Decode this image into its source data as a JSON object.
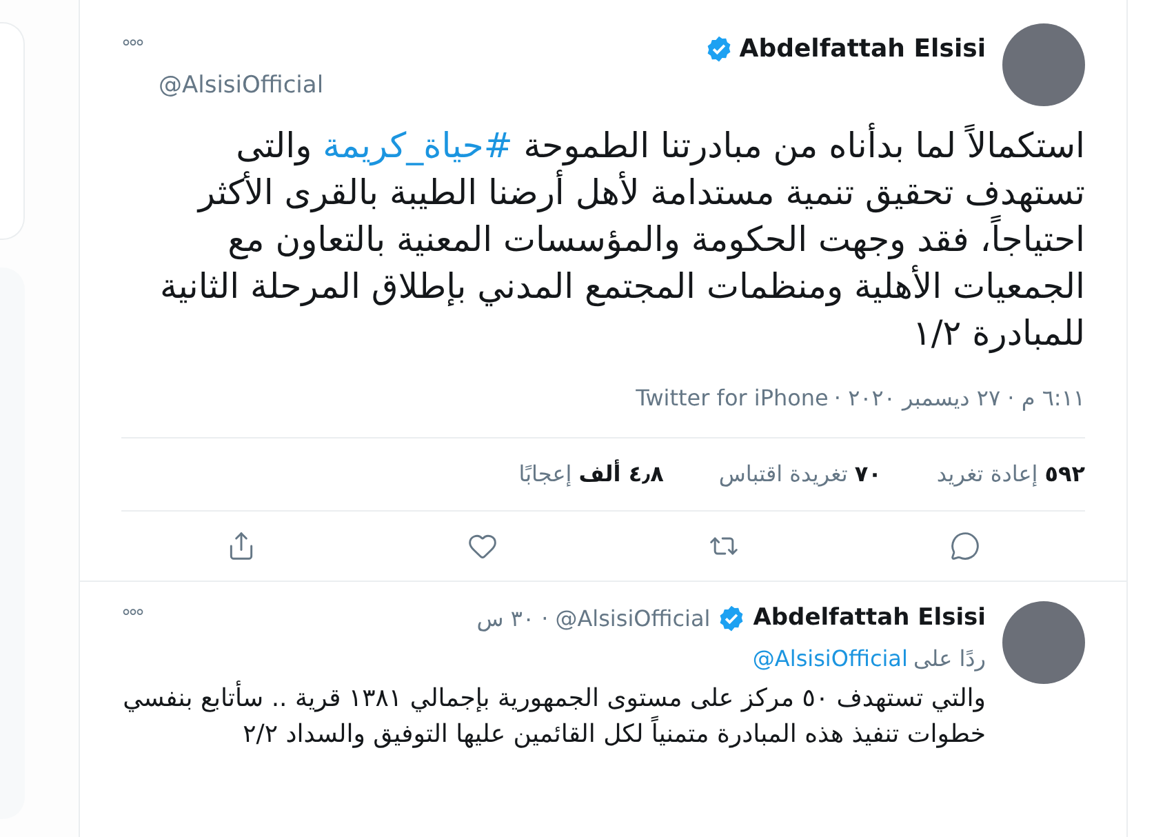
{
  "tweet": {
    "name": "Abdelfattah Elsisi",
    "verified": true,
    "handle": "@AlsisiOfficial",
    "more": "°°°",
    "text": [
      {
        "kind": "plain",
        "text": "استكمالاً لما بدأناه من مبادرتنا الطموحة "
      },
      {
        "kind": "hashtag",
        "text": "#حياة_كريمة"
      },
      {
        "kind": "plain",
        "text": " والتى تستهدف تحقيق تنمية مستدامة لأهل أرضنا الطيبة بالقرى الأكثر احتياجاً، فقد وجهت الحكومة والمؤسسات المعنية بالتعاون مع الجمعيات الأهلية ومنظمات المجتمع المدني بإطلاق المرحلة الثانية للمبادرة ١/٢"
      }
    ],
    "time": "٦:١١ م · ٢٧ ديسمبر ٢٠٢٠ · ",
    "source": "Twitter for iPhone",
    "stats": [
      {
        "count": "٥٩٢",
        "label": "إعادة تغريد"
      },
      {
        "count": "٧٠",
        "label": "تغريدة اقتباس"
      },
      {
        "count": "٤٫٨ ألف",
        "label": "إعجابًا"
      }
    ],
    "actions": [
      {
        "kind": "reply"
      },
      {
        "kind": "retweet"
      },
      {
        "kind": "like"
      },
      {
        "kind": "share"
      }
    ]
  },
  "reply": {
    "name": "Abdelfattah Elsisi",
    "verified": true,
    "handle": "@AlsisiOfficial",
    "separator": "·",
    "time": "٣٠ س",
    "more": "°°°",
    "replying_to": "ردًا على",
    "replying_handle": "@AlsisiOfficial",
    "text": "والتي تستهدف ٥٠ مركز على مستوى الجمهورية بإجمالي ١٣٨١ قرية .. سأتابع بنفسي خطوات تنفيذ هذه المبادرة متمنياً لكل القائمين عليها التوفيق والسداد ٢/٢"
  }
}
